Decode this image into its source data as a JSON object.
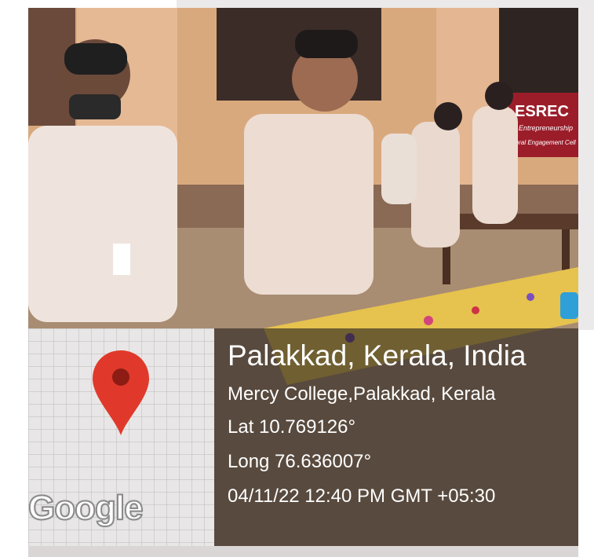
{
  "geotag": {
    "place_title": "Palakkad, Kerala, India",
    "address": "Mercy College,Palakkad, Kerala",
    "latitude": "Lat 10.769126°",
    "longitude": "Long 76.636007°",
    "datetime": "04/11/22 12:40 PM GMT +05:30"
  },
  "map": {
    "logo_text": "Google",
    "pin_color": "#e0392b",
    "pin_icon": "map-pin-icon"
  },
  "photo": {
    "banner_text_1": "ESREC",
    "banner_text_2": "Entrepreneurship",
    "banner_text_3": "Rural Engagement Cell"
  },
  "colors": {
    "info_panel": "#26221e",
    "text": "#ffffff"
  }
}
